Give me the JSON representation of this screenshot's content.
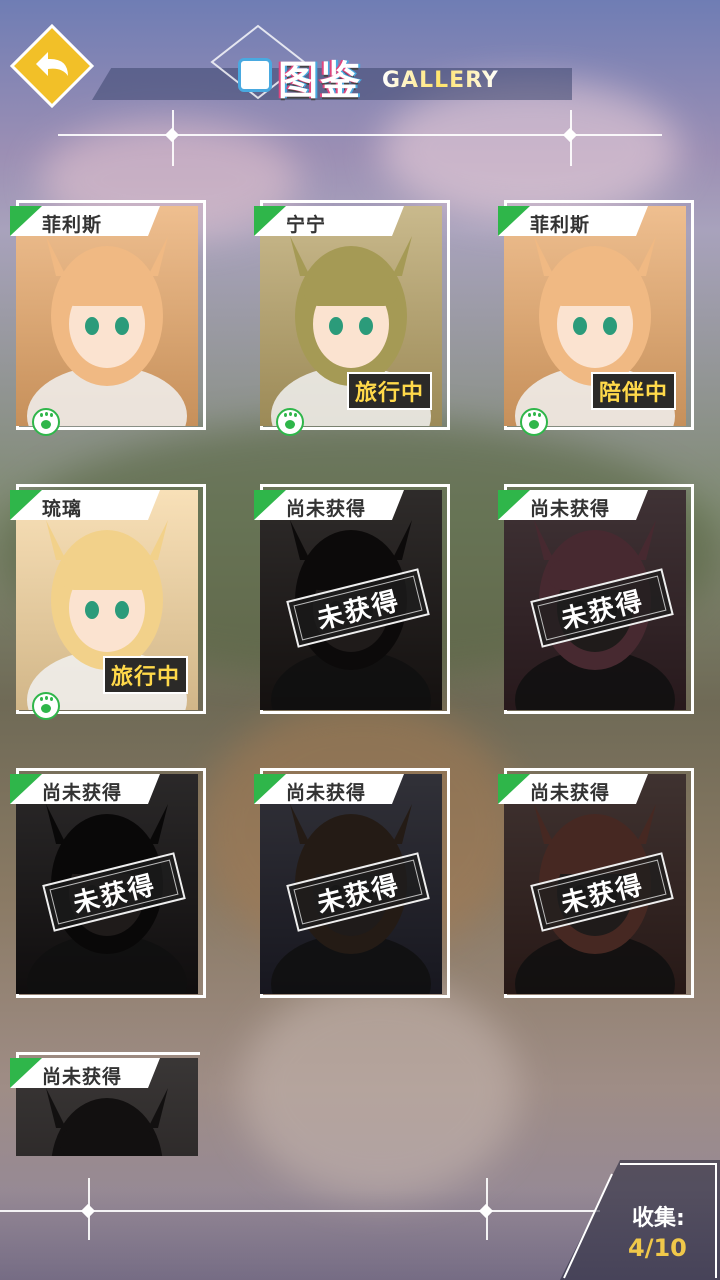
{
  "header": {
    "title_cn": "图鉴",
    "title_en": "GALLERY",
    "back_icon": "back-arrow-icon",
    "accent": "#f2c028"
  },
  "cards": [
    {
      "name": "菲利斯",
      "status": "",
      "locked": false,
      "paw": true,
      "portrait_color": "#e9a96a",
      "hair": "#f0b983"
    },
    {
      "name": "宁宁",
      "status": "旅行中",
      "locked": false,
      "paw": true,
      "portrait_color": "#b7a266",
      "hair": "#a59a55"
    },
    {
      "name": "菲利斯",
      "status": "陪伴中",
      "locked": false,
      "paw": true,
      "portrait_color": "#e9a96a",
      "hair": "#f0b983"
    },
    {
      "name": "琉璃",
      "status": "旅行中",
      "locked": false,
      "paw": true,
      "portrait_color": "#f6d6a0",
      "hair": "#f2d18a"
    },
    {
      "name": "尚未获得",
      "status": "",
      "locked": true,
      "stamp": "未获得",
      "portrait_color": "#3a2a25",
      "hair": "#1e1615"
    },
    {
      "name": "尚未获得",
      "status": "",
      "locked": true,
      "stamp": "未获得",
      "portrait_color": "#7a3a48",
      "hair": "#c0506a"
    },
    {
      "name": "尚未获得",
      "status": "",
      "locked": true,
      "stamp": "未获得",
      "portrait_color": "#2c2224",
      "hair": "#161112"
    },
    {
      "name": "尚未获得",
      "status": "",
      "locked": true,
      "stamp": "未获得",
      "portrait_color": "#3b3a5e",
      "hair": "#5a3a24"
    },
    {
      "name": "尚未获得",
      "status": "",
      "locked": true,
      "stamp": "未获得",
      "portrait_color": "#7a3a30",
      "hair": "#c0503a"
    },
    {
      "name": "尚未获得",
      "status": "",
      "locked": true,
      "stamp": "",
      "portrait_color": "#5a4a48",
      "hair": "#2a2222"
    }
  ],
  "footer": {
    "collect_label": "收集:",
    "collect_value": "4/10"
  }
}
